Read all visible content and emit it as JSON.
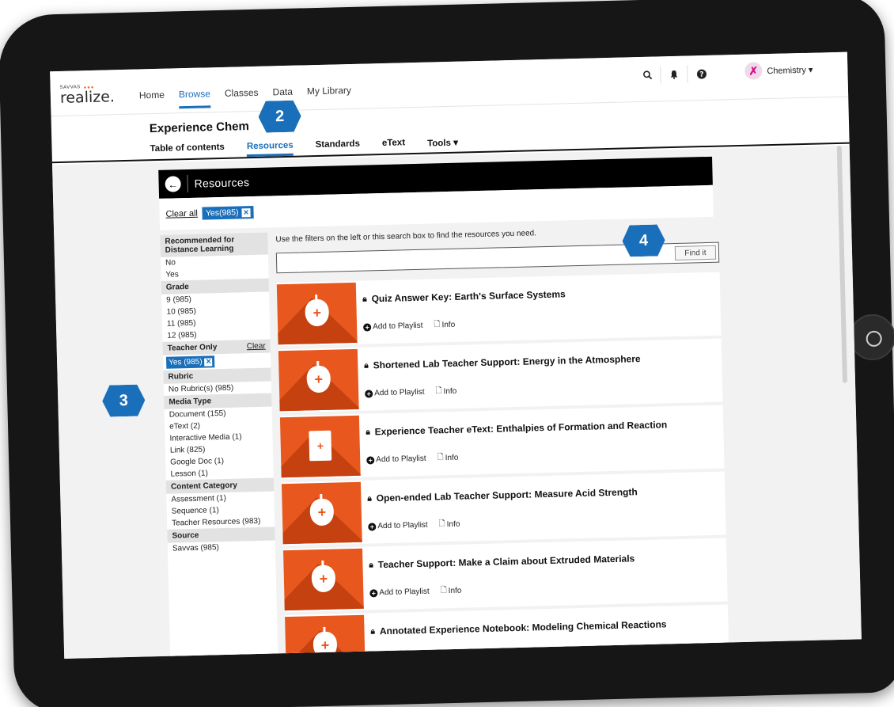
{
  "brand": {
    "small": "SAVVAS",
    "name": "realize."
  },
  "nav": {
    "items": [
      "Home",
      "Browse",
      "Classes",
      "Data",
      "My Library"
    ],
    "active": "Browse"
  },
  "header_icons": [
    "search-icon",
    "bell-icon",
    "help-icon"
  ],
  "user": {
    "label": "Chemistry ▾"
  },
  "program": {
    "title": "Experience Chem",
    "tabs": [
      "Table of contents",
      "Resources",
      "Standards",
      "eText",
      "Tools ▾"
    ],
    "active_tab": "Resources"
  },
  "resources_bar": {
    "title": "Resources"
  },
  "applied_filters": {
    "clear_all": "Clear all",
    "chip": "Yes(985)"
  },
  "filters": {
    "distance": {
      "heading": "Recommended for Distance Learning",
      "options": [
        "No",
        "Yes"
      ]
    },
    "grade": {
      "heading": "Grade",
      "options": [
        "9 (985)",
        "10 (985)",
        "11 (985)",
        "12 (985)"
      ]
    },
    "teacher_only": {
      "heading": "Teacher Only",
      "clear": "Clear",
      "selected": "Yes (985)"
    },
    "rubric": {
      "heading": "Rubric",
      "options": [
        "No Rubric(s) (985)"
      ]
    },
    "media_type": {
      "heading": "Media Type",
      "options": [
        "Document (155)",
        "eText (2)",
        "Interactive Media (1)",
        "Link (825)",
        "Google Doc (1)",
        "Lesson (1)"
      ]
    },
    "content_category": {
      "heading": "Content Category",
      "options": [
        "Assessment (1)",
        "Sequence (1)",
        "Teacher Resources (983)"
      ]
    },
    "source": {
      "heading": "Source",
      "options": [
        "Savvas (985)"
      ]
    }
  },
  "search": {
    "hint": "Use the filters on the left or this search box to find the resources you need.",
    "value": "",
    "button": "Find it"
  },
  "results": [
    {
      "title": "Quiz Answer Key: Earth's Surface Systems",
      "icon": "apple"
    },
    {
      "title": "Shortened Lab Teacher Support: Energy in the Atmosphere",
      "icon": "apple"
    },
    {
      "title": "Experience Teacher eText: Enthalpies of Formation and Reaction",
      "icon": "book"
    },
    {
      "title": "Open-ended Lab Teacher Support: Measure Acid Strength",
      "icon": "apple"
    },
    {
      "title": "Teacher Support: Make a Claim about Extruded Materials",
      "icon": "apple"
    },
    {
      "title": "Annotated Experience Notebook: Modeling Chemical Reactions",
      "icon": "apple"
    }
  ],
  "result_actions": {
    "add": "Add to Playlist",
    "info": "Info"
  },
  "callouts": [
    "2",
    "3",
    "4"
  ],
  "colors": {
    "accent": "#1a6fba",
    "resource_orange": "#e8581e",
    "frame": "#161616"
  }
}
